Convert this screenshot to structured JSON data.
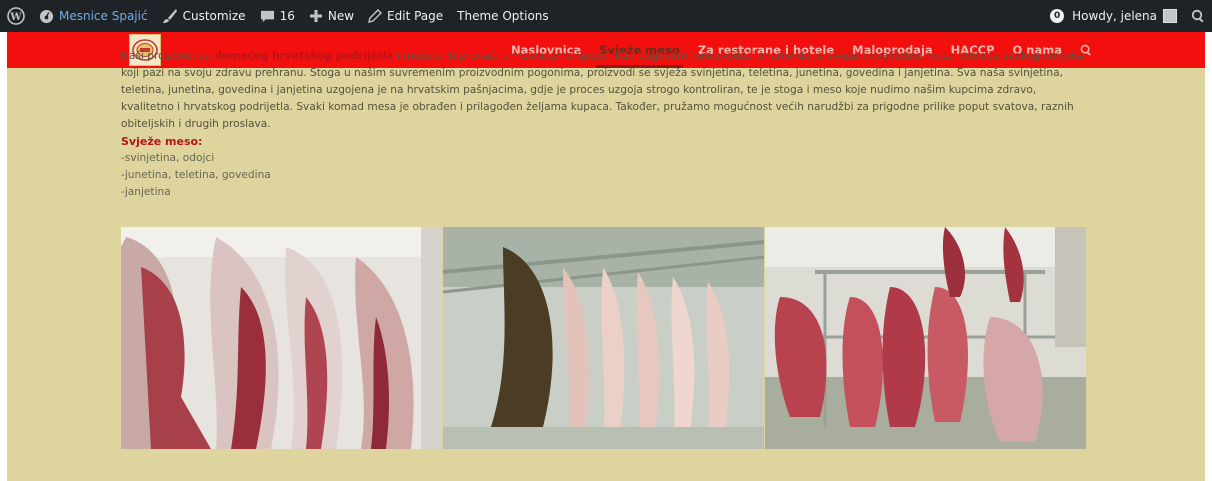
{
  "adminbar": {
    "site_name": "Mesnice Spajić",
    "customize": "Customize",
    "comments_count": "16",
    "new": "New",
    "edit_page": "Edit Page",
    "theme_options": "Theme Options",
    "notifications": "0",
    "howdy": "Howdy, jelena",
    "icons": {
      "wp": "wordpress-logo-icon",
      "site": "dashboard-icon",
      "customize": "paintbrush-icon",
      "comments": "comment-bubble-icon",
      "new": "plus-icon",
      "edit": "pencil-icon",
      "search": "search-icon"
    }
  },
  "nav": {
    "items": [
      {
        "label": "Naslovnica"
      },
      {
        "label": "Svježe meso"
      },
      {
        "label": "Za restorane i hotele"
      },
      {
        "label": "Maloprodaja"
      },
      {
        "label": "HACCP"
      },
      {
        "label": "O nama"
      }
    ],
    "active_index": 1,
    "search_icon": "search-icon"
  },
  "colors": {
    "adminbar_bg": "#1d2327",
    "navbar_bg": "#f40f0f",
    "content_bg": "#ddd59d",
    "accent_red": "#b5161a"
  },
  "content": {
    "intro_before": "Naši proizvodi su ",
    "intro_strong": "domaćeg hrvatskog podrijetla",
    "intro_after": " i možete ih pronaći u mesnicama Spajić. Kao odgovorni proizvođači znamo da je svježe i kvalitetno meso potreba svakog čovjeka koji pazi na svoju zdravu prehranu. Stoga u našim suvremenim proizvodnim pogonima, proizvodi se svježa svinjetina, teletina, junetina, govedina i janjetina. Sva naša svinjetina, teletina, junetina, govedina i janjetina uzgojena je na hrvatskim pašnjacima, gdje je proces uzgoja strogo kontroliran, te je stoga i meso koje nudimo našim kupcima zdravo, kvalitetno i hrvatskog podrijetla. Svaki komad mesa je obrađen i prilagođen željama kupaca. Također, pružamo mogućnost većih narudžbi za prigodne prilike poput svatova, raznih obiteljskih i drugih proslava.",
    "heading": "Svježe meso:",
    "list": [
      "-svinjetina, odojci",
      "-junetina, teletina, govedina",
      "-janjetina"
    ]
  }
}
